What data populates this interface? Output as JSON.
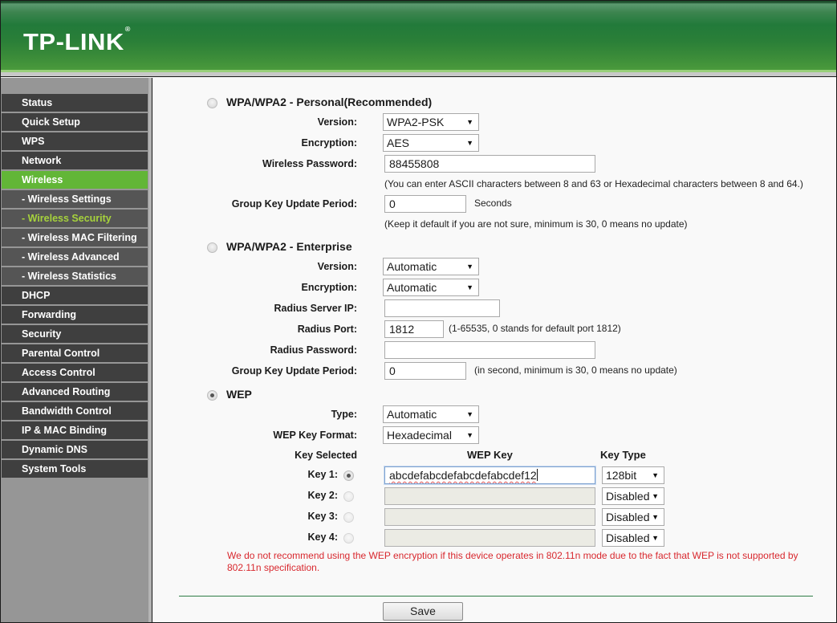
{
  "brand": {
    "logo_text": "TP-LINK",
    "registered_mark": "®"
  },
  "sidebar": {
    "items": [
      {
        "label": "Status",
        "type": "main",
        "state": "normal"
      },
      {
        "label": "Quick Setup",
        "type": "main",
        "state": "normal"
      },
      {
        "label": "WPS",
        "type": "main",
        "state": "normal"
      },
      {
        "label": "Network",
        "type": "main",
        "state": "normal"
      },
      {
        "label": "Wireless",
        "type": "main",
        "state": "active"
      },
      {
        "label": "- Wireless Settings",
        "type": "sub",
        "state": "normal"
      },
      {
        "label": "- Wireless Security",
        "type": "sub",
        "state": "current"
      },
      {
        "label": "- Wireless MAC Filtering",
        "type": "sub",
        "state": "normal"
      },
      {
        "label": "- Wireless Advanced",
        "type": "sub",
        "state": "normal"
      },
      {
        "label": "- Wireless Statistics",
        "type": "sub",
        "state": "normal"
      },
      {
        "label": "DHCP",
        "type": "main",
        "state": "normal"
      },
      {
        "label": "Forwarding",
        "type": "main",
        "state": "normal"
      },
      {
        "label": "Security",
        "type": "main",
        "state": "normal"
      },
      {
        "label": "Parental Control",
        "type": "main",
        "state": "normal"
      },
      {
        "label": "Access Control",
        "type": "main",
        "state": "normal"
      },
      {
        "label": "Advanced Routing",
        "type": "main",
        "state": "normal"
      },
      {
        "label": "Bandwidth Control",
        "type": "main",
        "state": "normal"
      },
      {
        "label": "IP & MAC Binding",
        "type": "main",
        "state": "normal"
      },
      {
        "label": "Dynamic DNS",
        "type": "main",
        "state": "normal"
      },
      {
        "label": "System Tools",
        "type": "main",
        "state": "normal"
      }
    ]
  },
  "personal": {
    "title": "WPA/WPA2 - Personal(Recommended)",
    "selected": false,
    "version_label": "Version:",
    "version_value": "WPA2-PSK",
    "encryption_label": "Encryption:",
    "encryption_value": "AES",
    "password_label": "Wireless Password:",
    "password_value": "88455808",
    "password_hint": "(You can enter ASCII characters between 8 and 63 or Hexadecimal characters between 8 and 64.)",
    "gkup_label": "Group Key Update Period:",
    "gkup_value": "0",
    "gkup_unit": "Seconds",
    "gkup_hint": "(Keep it default if you are not sure, minimum is 30, 0 means no update)"
  },
  "enterprise": {
    "title": "WPA/WPA2 - Enterprise",
    "selected": false,
    "version_label": "Version:",
    "version_value": "Automatic",
    "encryption_label": "Encryption:",
    "encryption_value": "Automatic",
    "radius_ip_label": "Radius Server IP:",
    "radius_ip_value": "",
    "radius_port_label": "Radius Port:",
    "radius_port_value": "1812",
    "radius_port_hint": "(1-65535, 0 stands for default port 1812)",
    "radius_password_label": "Radius Password:",
    "radius_password_value": "",
    "gkup_label": "Group Key Update Period:",
    "gkup_value": "0",
    "gkup_hint": "(in second, minimum is 30, 0 means no update)"
  },
  "wep": {
    "title": "WEP",
    "selected": true,
    "type_label": "Type:",
    "type_value": "Automatic",
    "format_label": "WEP Key Format:",
    "format_value": "Hexadecimal",
    "col_key_selected": "Key Selected",
    "col_wep_key": "WEP Key",
    "col_key_type": "Key Type",
    "keys": [
      {
        "label": "Key 1:",
        "selected": true,
        "value": "abcdefabcdefabcdefabcdef12",
        "type": "128bit",
        "enabled": true
      },
      {
        "label": "Key 2:",
        "selected": false,
        "value": "",
        "type": "Disabled",
        "enabled": false
      },
      {
        "label": "Key 3:",
        "selected": false,
        "value": "",
        "type": "Disabled",
        "enabled": false
      },
      {
        "label": "Key 4:",
        "selected": false,
        "value": "",
        "type": "Disabled",
        "enabled": false
      }
    ],
    "warning": "We do not recommend using the WEP encryption if this device operates in 802.11n mode due to the fact that WEP is not supported by 802.11n specification."
  },
  "actions": {
    "save_label": "Save"
  },
  "colors": {
    "brand_green": "#2a7f38",
    "menu_active": "#62b637",
    "menu_current_text": "#a6d23c",
    "warning_text": "#d8282e"
  }
}
